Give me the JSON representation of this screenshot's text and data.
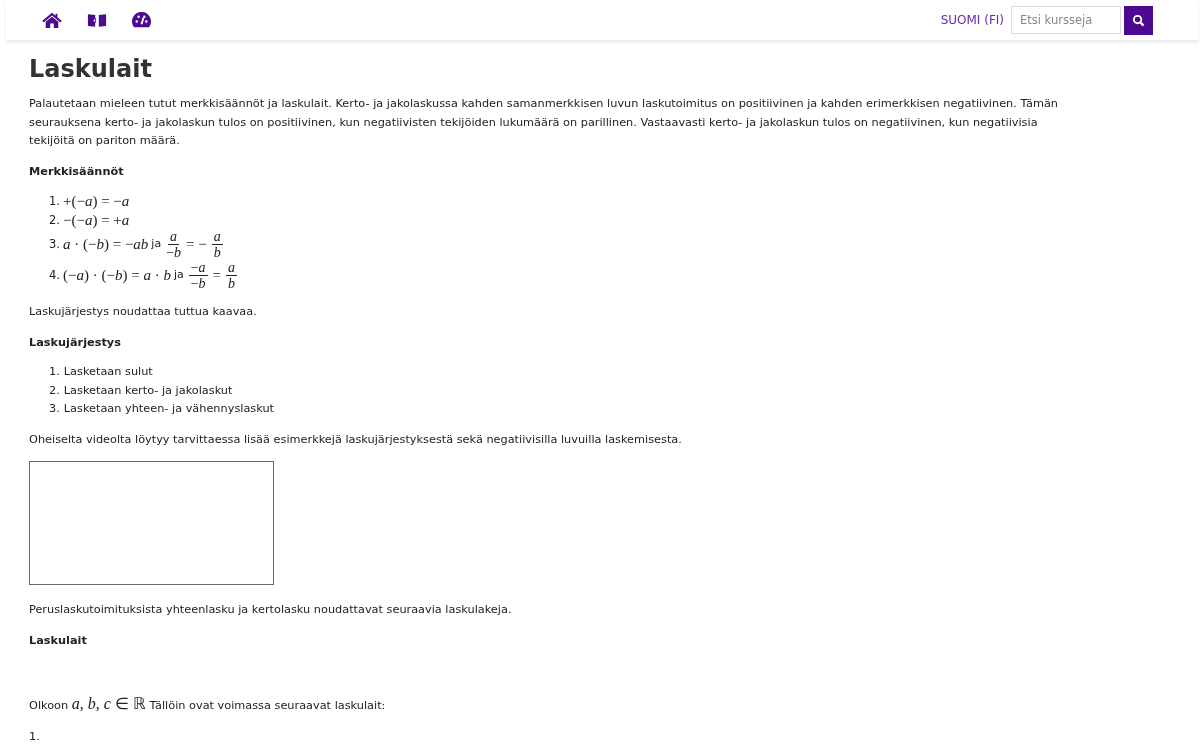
{
  "nav": {
    "language": "SUOMI (FI)",
    "search": {
      "placeholder": "Etsi kursseja"
    }
  },
  "title": "Laskulait",
  "blocks": [
    {
      "kind": "paragraph",
      "text": "Palautetaan mieleen tutut merkkisäännöt ja laskulait. Kerto- ja jakolaskussa kahden samanmerkkisen luvun laskutoimitus on positiivinen ja kahden erimerkkisen negatiivinen. Tämän seurauksena kerto- ja jakolaskun tulos on positiivinen, kun negatiivisten tekijöiden lukumäärä on parillinen. Vastaavasti kerto- ja jakolaskun tulos on negatiivinen, kun negatiivisia tekijöitä on pariton määrä."
    },
    {
      "kind": "heading",
      "text": "Merkkisäännöt"
    },
    {
      "kind": "math_list",
      "items": [
        {
          "number": "1.",
          "parts": [
            {
              "kind": "math",
              "text": "+(−*a*) = −*a*"
            }
          ]
        },
        {
          "number": "2.",
          "parts": [
            {
              "kind": "math",
              "text": "−(−*a*) = +*a*"
            }
          ]
        },
        {
          "number": "3.",
          "parts": [
            {
              "kind": "math",
              "text": "*a* · (−*b*) = −*ab*"
            },
            {
              "kind": "text",
              "text": "ja"
            },
            {
              "kind": "frac",
              "num": "*a*",
              "den": "−*b*"
            },
            {
              "kind": "math",
              "text": "= −"
            },
            {
              "kind": "frac",
              "num": "*a*",
              "den": "*b*"
            }
          ]
        },
        {
          "number": "4.",
          "parts": [
            {
              "kind": "math",
              "text": "(−*a*) · (−*b*) = *a* · *b*"
            },
            {
              "kind": "text",
              "text": "ja"
            },
            {
              "kind": "frac",
              "num": "−*a*",
              "den": "−*b*"
            },
            {
              "kind": "math",
              "text": "="
            },
            {
              "kind": "frac",
              "num": "*a*",
              "den": "*b*"
            }
          ]
        }
      ]
    },
    {
      "kind": "paragraph",
      "text": "Laskujärjestys noudattaa tuttua kaavaa."
    },
    {
      "kind": "heading",
      "text": "Laskujärjestys"
    },
    {
      "kind": "list",
      "items": [
        {
          "number": "1.",
          "text": "Lasketaan sulut"
        },
        {
          "number": "2.",
          "text": "Lasketaan kerto- ja jakolaskut"
        },
        {
          "number": "3.",
          "text": "Lasketaan yhteen- ja vähennyslaskut"
        }
      ]
    },
    {
      "kind": "paragraph",
      "text": "Oheiselta videolta löytyy tarvittaessa lisää esimerkkejä laskujärjestyksestä sekä negatiivisilla luvuilla laskemisesta."
    },
    {
      "kind": "video"
    },
    {
      "kind": "paragraph",
      "text": "Peruslaskutoimituksista yhteenlasku ja kertolasku noudattavat seuraavia laskulakeja."
    },
    {
      "kind": "heading",
      "text": "Laskulait"
    },
    {
      "kind": "spacer"
    },
    {
      "kind": "math_paragraph",
      "parts": [
        {
          "kind": "text",
          "text": "Olkoon"
        },
        {
          "kind": "math",
          "text": "*a*, *b*, *c* ∈ ℝ"
        },
        {
          "kind": "text",
          "text": "Tällöin ovat voimassa seuraavat laskulait:"
        }
      ]
    },
    {
      "kind": "paragraph",
      "text": "1."
    }
  ]
}
